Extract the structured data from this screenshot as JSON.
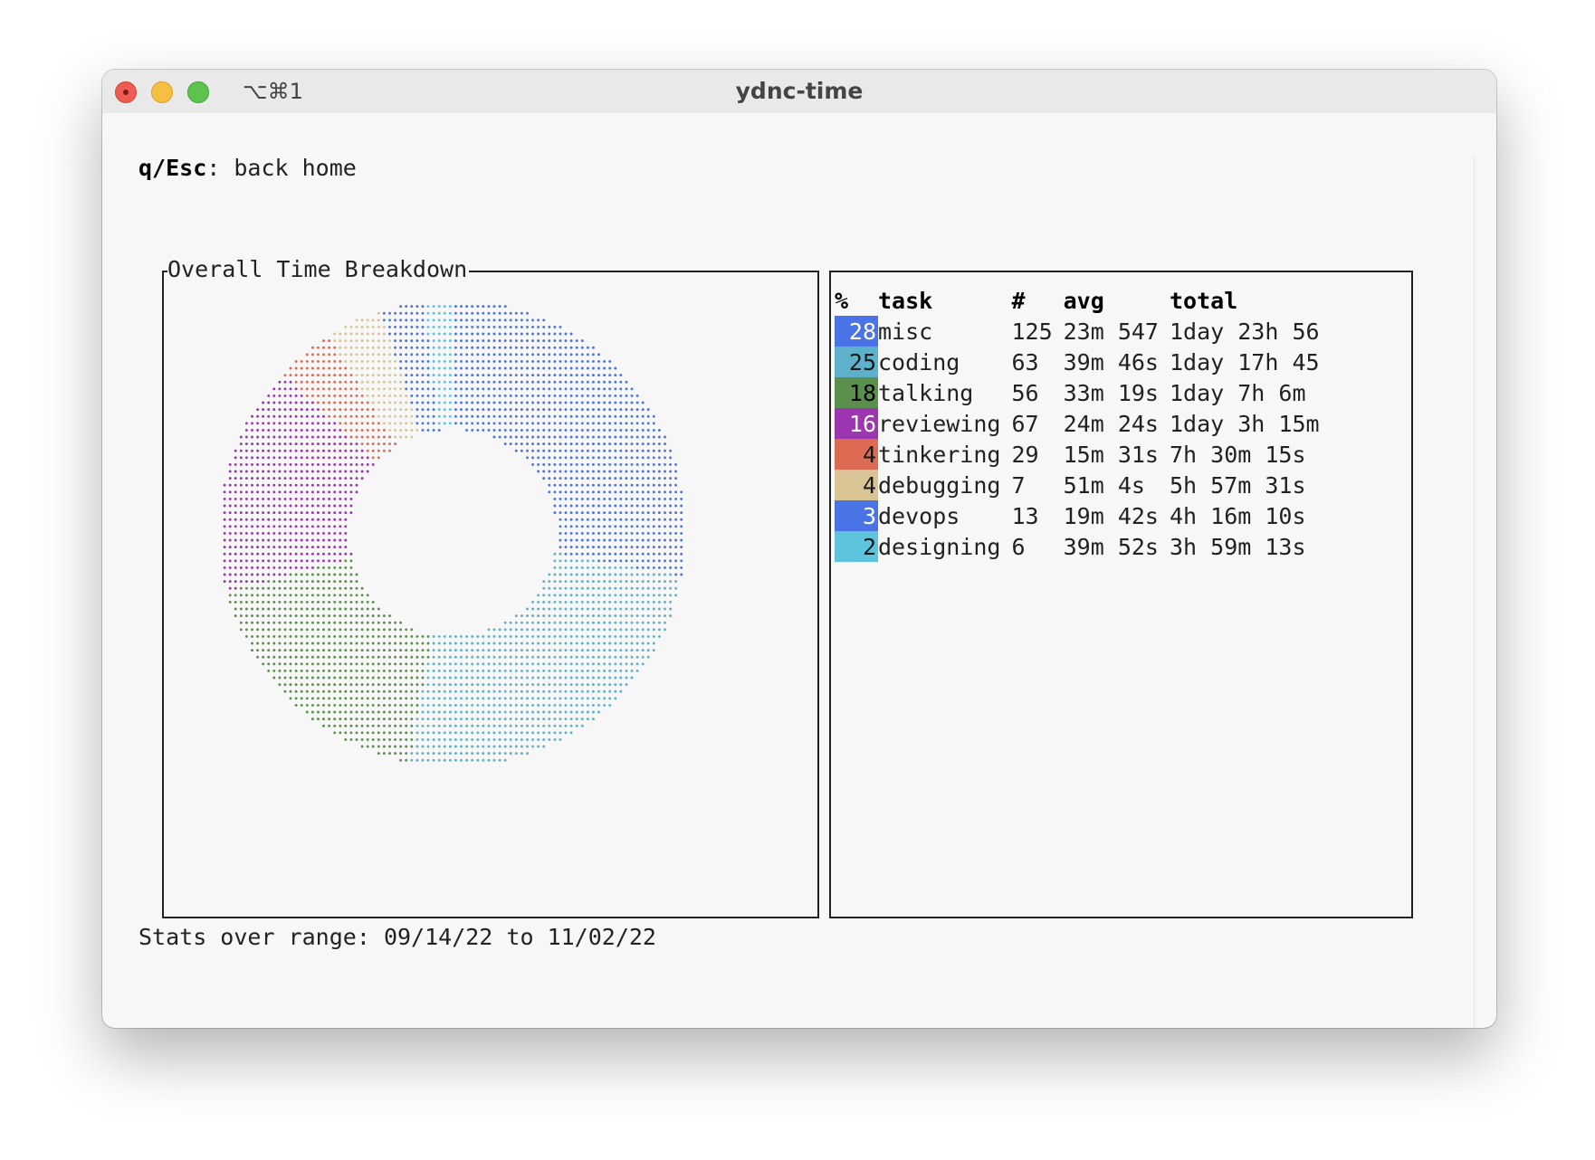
{
  "window": {
    "title": "ydnc-time",
    "shortcut": "⌥⌘1"
  },
  "help": {
    "keys": "q/Esc",
    "separator": ": ",
    "action": "back home"
  },
  "chart_panel": {
    "title": "Overall Time Breakdown"
  },
  "table": {
    "headers": [
      "%",
      "task",
      "#",
      "avg",
      "total"
    ],
    "rows": [
      {
        "pct": "28",
        "task": "misc",
        "count": "125",
        "avg": "23m 547",
        "total": "1day 23h 56",
        "color": "#4a74e6",
        "text_color": "#ffffff"
      },
      {
        "pct": "25",
        "task": "coding",
        "count": "63",
        "avg": "39m 46s",
        "total": "1day 17h 45",
        "color": "#5eb1cb",
        "text_color": "#1a1a1a"
      },
      {
        "pct": "18",
        "task": "talking",
        "count": "56",
        "avg": "33m 19s",
        "total": "1day 7h 6m",
        "color": "#5a8f4e",
        "text_color": "#000000"
      },
      {
        "pct": "16",
        "task": "reviewing",
        "count": "67",
        "avg": "24m 24s",
        "total": "1day 3h 15m",
        "color": "#9b36b0",
        "text_color": "#ffffff"
      },
      {
        "pct": "4",
        "task": "tinkering",
        "count": "29",
        "avg": "15m 31s",
        "total": "7h 30m 15s",
        "color": "#dd6a52",
        "text_color": "#1a1a1a"
      },
      {
        "pct": "4",
        "task": "debugging",
        "count": "7",
        "avg": "51m 4s",
        "total": "5h 57m 31s",
        "color": "#d8c495",
        "text_color": "#1a1a1a"
      },
      {
        "pct": "3",
        "task": "devops",
        "count": "13",
        "avg": "19m 42s",
        "total": "4h 16m 10s",
        "color": "#4a74e6",
        "text_color": "#ffffff"
      },
      {
        "pct": "2",
        "task": "designing",
        "count": "6",
        "avg": "39m 52s",
        "total": "3h 59m 13s",
        "color": "#5ec4dd",
        "text_color": "#1a1a1a"
      }
    ]
  },
  "footer": {
    "label": "Stats over range: ",
    "start": "09/14/22",
    "to": " to ",
    "end": "11/02/22"
  },
  "chart_data": {
    "type": "pie",
    "style": "donut",
    "title": "Overall Time Breakdown",
    "categories": [
      "misc",
      "coding",
      "talking",
      "reviewing",
      "tinkering",
      "debugging",
      "devops",
      "designing"
    ],
    "values": [
      28,
      25,
      18,
      16,
      4,
      4,
      3,
      2
    ],
    "colors": [
      "#4a74e6",
      "#5eb1cb",
      "#5a8f4e",
      "#9b36b0",
      "#dd6a52",
      "#d8c495",
      "#4a74e6",
      "#5ec4dd"
    ]
  }
}
